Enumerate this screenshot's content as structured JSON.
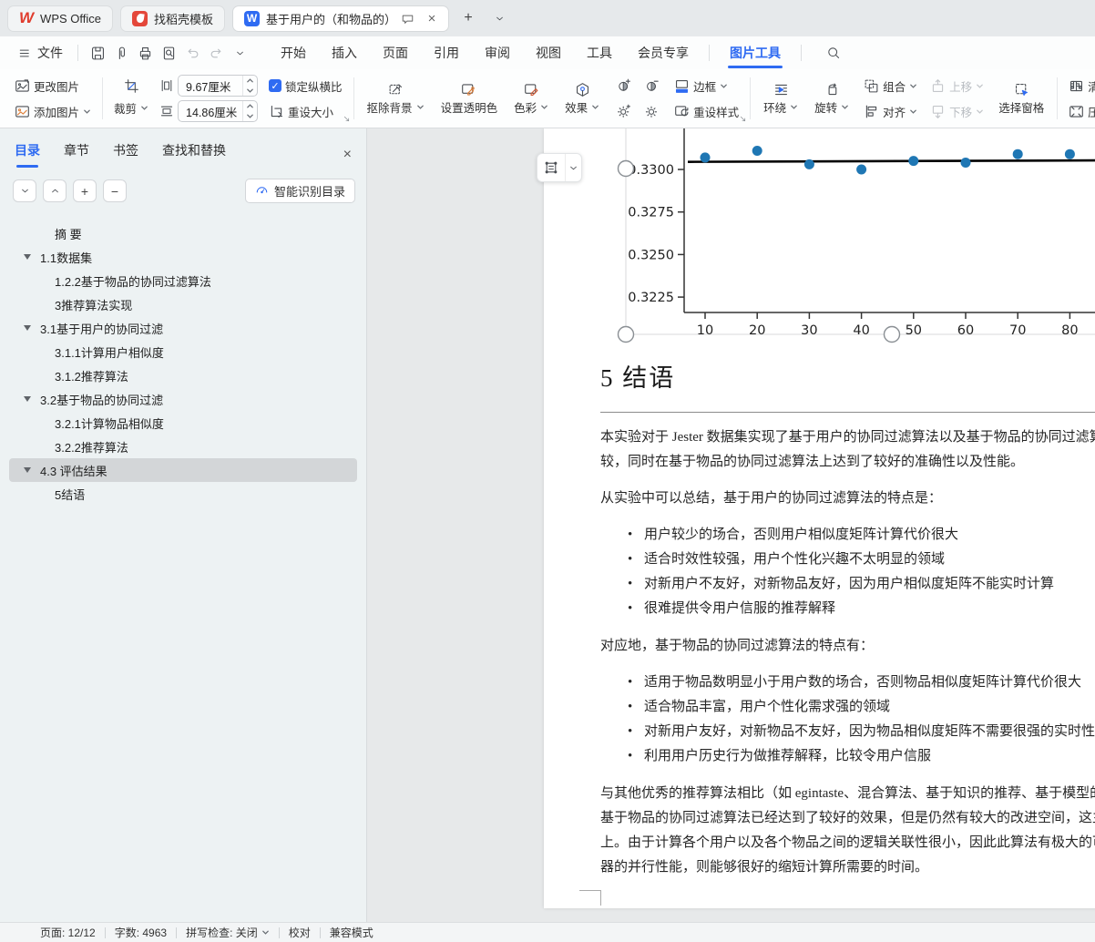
{
  "tabbar": {
    "home_tab": "WPS Office",
    "docer_tab": "找稻壳模板",
    "doc_tab": "基于用户的（和物品的）协同",
    "close": "×",
    "new_tab": "+"
  },
  "menubar": {
    "file": "文件",
    "menus": [
      "开始",
      "插入",
      "页面",
      "引用",
      "审阅",
      "视图",
      "工具",
      "会员专享"
    ],
    "active_menu": "图片工具"
  },
  "ribbon": {
    "change_picture": "更改图片",
    "add_picture": "添加图片",
    "crop": "裁剪",
    "height_value": "9.67厘米",
    "width_value": "14.86厘米",
    "lock_ratio": "锁定纵横比",
    "check": "✓",
    "reset_size": "重设大小",
    "matting": "抠除背景",
    "transparent": "设置透明色",
    "color": "色彩",
    "effect": "效果",
    "border": "边框",
    "reset_style": "重设样式",
    "wrap": "环绕",
    "rotate": "旋转",
    "group": "组合",
    "align": "对齐",
    "move_up": "上移",
    "move_down": "下移",
    "selection_pane": "选择窗格",
    "sharpen": "清晰化",
    "compress": "压缩图片"
  },
  "sidebar": {
    "tabs": [
      "目录",
      "章节",
      "书签",
      "查找和替换"
    ],
    "active_tab": "目录",
    "close": "×",
    "smart_button": "智能识别目录",
    "toc": [
      {
        "label": "摘 要",
        "level": 2,
        "arrow": false,
        "selected": false
      },
      {
        "label": "1.1数据集",
        "level": 1,
        "arrow": true,
        "selected": false
      },
      {
        "label": "1.2.2基于物品的协同过滤算法",
        "level": 2,
        "arrow": false,
        "selected": false
      },
      {
        "label": "3推荐算法实现",
        "level": 2,
        "arrow": false,
        "selected": false
      },
      {
        "label": "3.1基于用户的协同过滤",
        "level": 1,
        "arrow": true,
        "selected": false
      },
      {
        "label": "3.1.1计算用户相似度",
        "level": 2,
        "arrow": false,
        "selected": false
      },
      {
        "label": "3.1.2推荐算法",
        "level": 2,
        "arrow": false,
        "selected": false
      },
      {
        "label": "3.2基于物品的协同过滤",
        "level": 1,
        "arrow": true,
        "selected": false
      },
      {
        "label": "3.2.1计算物品相似度",
        "level": 2,
        "arrow": false,
        "selected": false
      },
      {
        "label": "3.2.2推荐算法",
        "level": 2,
        "arrow": false,
        "selected": false
      },
      {
        "label": "4.3 评估结果",
        "level": 1,
        "arrow": true,
        "selected": true
      },
      {
        "label": "5结语",
        "level": 2,
        "arrow": false,
        "selected": false
      }
    ]
  },
  "document": {
    "heading": "5 结语",
    "para1": [
      "本实验对于 Jester 数据集实现了基于用户的协同过滤算法以及基于物品的协同过滤算法，并将其",
      "较，同时在基于物品的协同过滤算法上达到了较好的准确性以及性能。"
    ],
    "para2": [
      "从实验中可以总结，基于用户的协同过滤算法的特点是："
    ],
    "bullets1": [
      "用户较少的场合，否则用户相似度矩阵计算代价很大",
      "适合时效性较强，用户个性化兴趣不太明显的领域",
      "对新用户不友好，对新物品友好，因为用户相似度矩阵不能实时计算",
      "很难提供令用户信服的推荐解释"
    ],
    "para3": [
      "对应地，基于物品的协同过滤算法的特点有："
    ],
    "bullets2": [
      "适用于物品数明显小于用户数的场合，否则物品相似度矩阵计算代价很大",
      "适合物品丰富，用户个性化需求强的领域",
      "对新用户友好，对新物品不友好，因为物品相似度矩阵不需要很强的实时性",
      "利用用户历史行为做推荐解释，比较令用户信服"
    ],
    "para4": [
      "与其他优秀的推荐算法相比（如 egintaste、混合算法、基于知识的推荐、基于模型的协同过滤等",
      "基于物品的协同过滤算法已经达到了较好的效果，但是仍然有较大的改进空间，这主要体现在计",
      "上。由于计算各个用户以及各个物品之间的逻辑关联性很小，因此此算法有极大的可并行性，若",
      "器的并行性能，则能够很好的缩短计算所需要的时间。"
    ]
  },
  "chart_data": {
    "type": "scatter",
    "x": [
      10,
      20,
      30,
      40,
      50,
      60,
      70,
      80
    ],
    "y": [
      0.3307,
      0.3311,
      0.3303,
      0.33,
      0.3305,
      0.3304,
      0.3309,
      0.3309
    ],
    "fit_line_y": 0.3305,
    "yticks": [
      0.33,
      0.3275,
      0.325,
      0.3225
    ],
    "xticks": [
      10,
      20,
      30,
      40,
      50,
      60,
      70,
      80
    ],
    "point_color": "#1f77b4",
    "line_color": "#000000",
    "note": "chart truncated at top and right edge of viewport; image selected with handles"
  },
  "statusbar": {
    "items": [
      "页面: 12/12",
      "字数: 4963",
      "拼写检查: 关闭",
      "校对",
      "兼容模式"
    ],
    "caret_item": "拼写检查: 关闭"
  },
  "colors": {
    "accent": "#2f6bf2",
    "wps_red": "#e03c2d",
    "scatter_blue": "#1f77b4",
    "sidebar_bg": "#edf2f3"
  }
}
